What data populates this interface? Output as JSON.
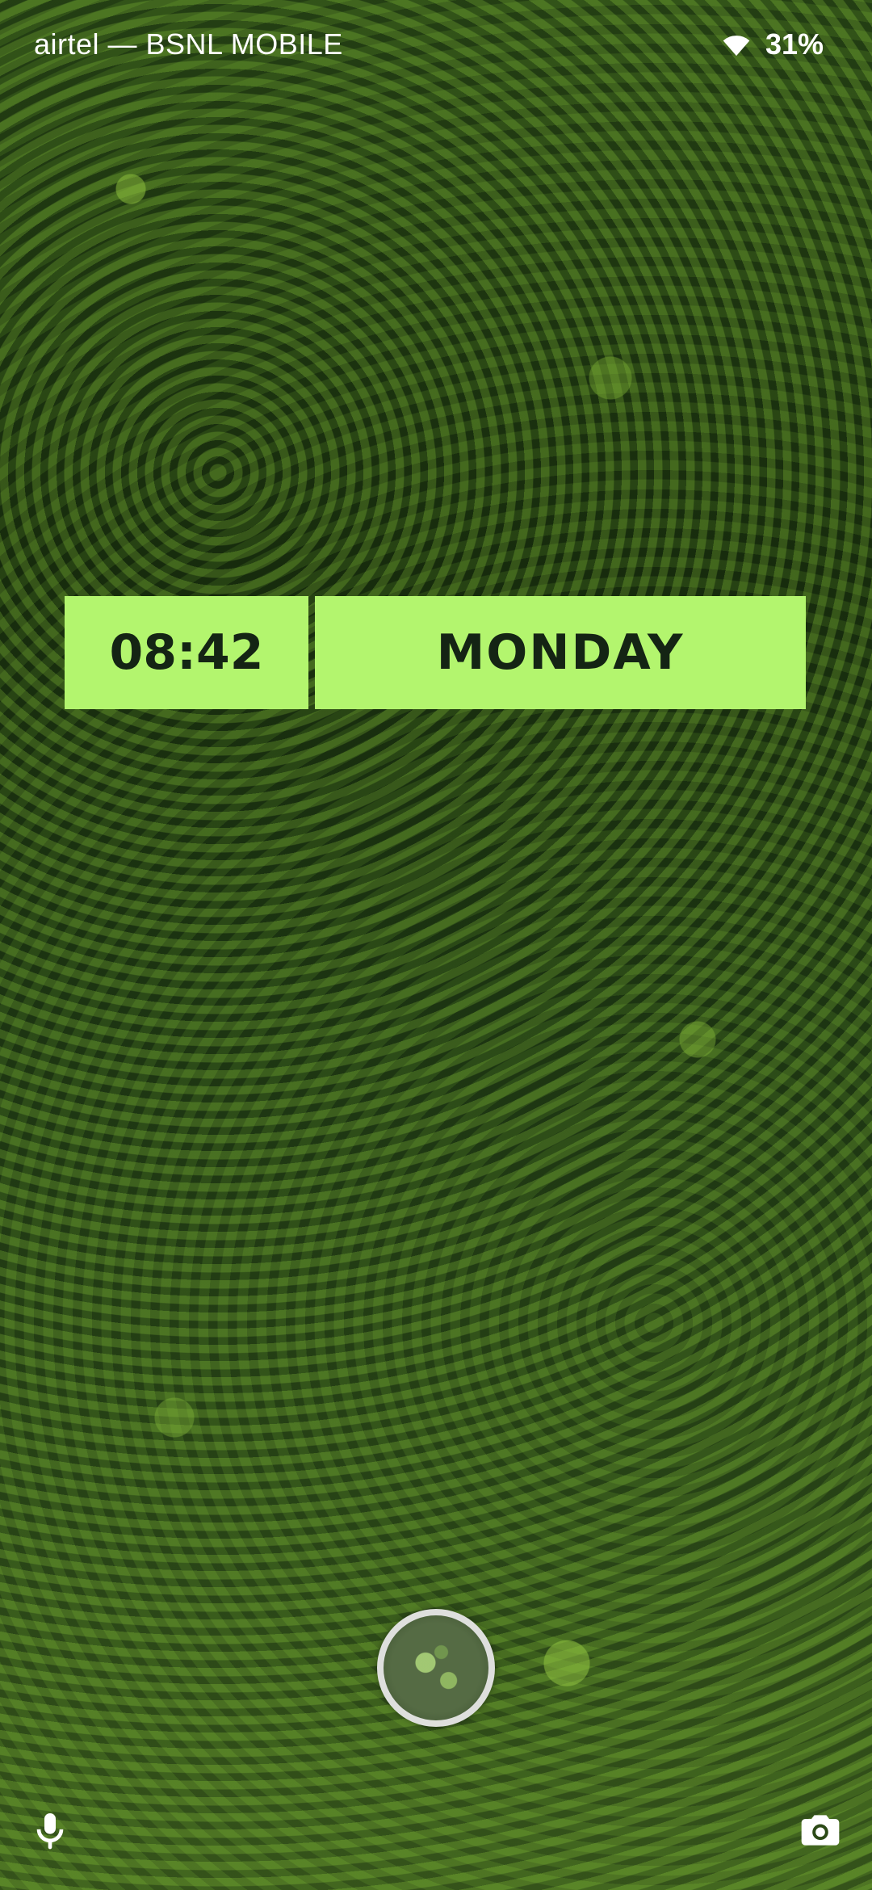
{
  "status_bar": {
    "carrier": "airtel — BSNL MOBILE",
    "battery_percent": "31%",
    "wifi_icon": "wifi-icon"
  },
  "lockscreen_widget": {
    "time": "08:42",
    "day": "MONDAY",
    "background_color": "#b3f56e",
    "text_color": "#142414"
  },
  "unlock": {
    "button_icon": "fingerprint-icon"
  },
  "shortcuts": {
    "left_icon": "microphone-icon",
    "right_icon": "camera-icon"
  }
}
